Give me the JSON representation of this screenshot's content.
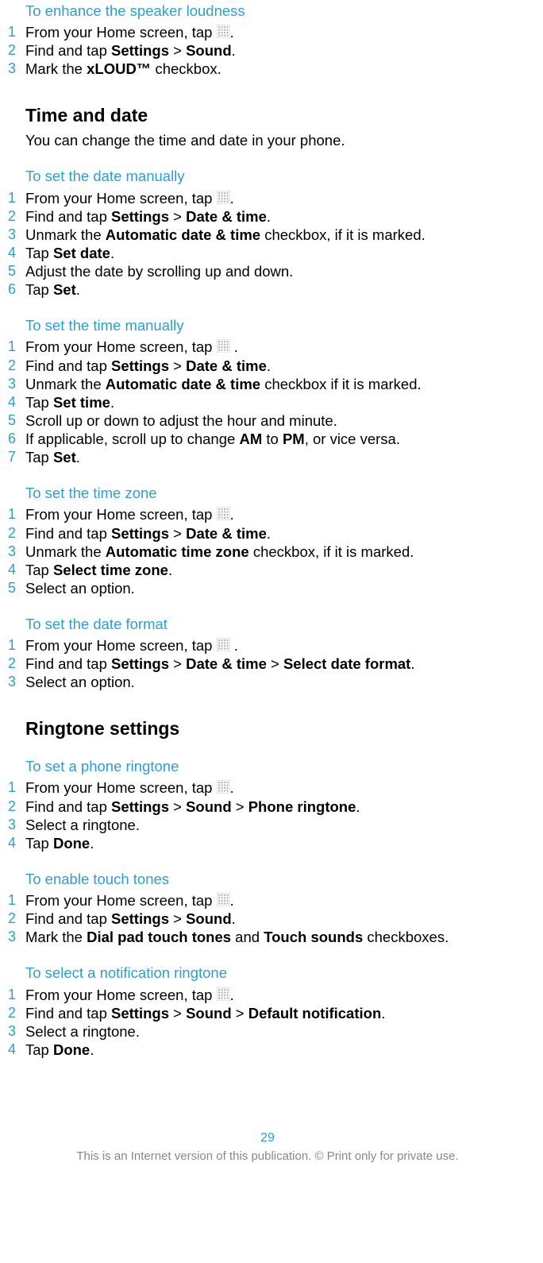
{
  "sections": [
    {
      "heading": "To enhance the speaker loudness",
      "first": true,
      "steps": [
        [
          {
            "t": "From your Home screen, tap "
          },
          {
            "icon": "apps"
          },
          {
            "t": "."
          }
        ],
        [
          {
            "t": "Find and tap "
          },
          {
            "b": "Settings"
          },
          {
            "t": " > "
          },
          {
            "b": "Sound"
          },
          {
            "t": "."
          }
        ],
        [
          {
            "t": "Mark the "
          },
          {
            "b": "xLOUD™"
          },
          {
            "t": " checkbox."
          }
        ]
      ]
    },
    {
      "h2": "Time and date",
      "intro": "You can change the time and date in your phone."
    },
    {
      "heading": "To set the date manually",
      "steps": [
        [
          {
            "t": "From your Home screen, tap "
          },
          {
            "icon": "apps"
          },
          {
            "t": "."
          }
        ],
        [
          {
            "t": "Find and tap "
          },
          {
            "b": "Settings"
          },
          {
            "t": " > "
          },
          {
            "b": "Date & time"
          },
          {
            "t": "."
          }
        ],
        [
          {
            "t": "Unmark the "
          },
          {
            "b": "Automatic date & time"
          },
          {
            "t": " checkbox, if it is marked."
          }
        ],
        [
          {
            "t": "Tap "
          },
          {
            "b": "Set date"
          },
          {
            "t": "."
          }
        ],
        [
          {
            "t": "Adjust the date by scrolling up and down."
          }
        ],
        [
          {
            "t": "Tap "
          },
          {
            "b": "Set"
          },
          {
            "t": "."
          }
        ]
      ]
    },
    {
      "heading": "To set the time manually",
      "steps": [
        [
          {
            "t": "From your Home screen, tap "
          },
          {
            "icon": "apps"
          },
          {
            "t": " ."
          }
        ],
        [
          {
            "t": "Find and tap "
          },
          {
            "b": "Settings"
          },
          {
            "t": " > "
          },
          {
            "b": "Date & time"
          },
          {
            "t": "."
          }
        ],
        [
          {
            "t": "Unmark the "
          },
          {
            "b": "Automatic date & time"
          },
          {
            "t": " checkbox if it is marked."
          }
        ],
        [
          {
            "t": "Tap "
          },
          {
            "b": "Set time"
          },
          {
            "t": "."
          }
        ],
        [
          {
            "t": "Scroll up or down to adjust the hour and minute."
          }
        ],
        [
          {
            "t": "If applicable, scroll up to change "
          },
          {
            "b": "AM"
          },
          {
            "t": " to "
          },
          {
            "b": "PM"
          },
          {
            "t": ", or vice versa."
          }
        ],
        [
          {
            "t": "Tap "
          },
          {
            "b": "Set"
          },
          {
            "t": "."
          }
        ]
      ]
    },
    {
      "heading": "To set the time zone",
      "steps": [
        [
          {
            "t": "From your Home screen, tap "
          },
          {
            "icon": "apps"
          },
          {
            "t": "."
          }
        ],
        [
          {
            "t": "Find and tap "
          },
          {
            "b": "Settings"
          },
          {
            "t": " > "
          },
          {
            "b": "Date & time"
          },
          {
            "t": "."
          }
        ],
        [
          {
            "t": "Unmark the "
          },
          {
            "b": "Automatic time zone"
          },
          {
            "t": " checkbox, if it is marked."
          }
        ],
        [
          {
            "t": "Tap "
          },
          {
            "b": "Select time zone"
          },
          {
            "t": "."
          }
        ],
        [
          {
            "t": "Select an option."
          }
        ]
      ]
    },
    {
      "heading": "To set the date format",
      "steps": [
        [
          {
            "t": "From your Home screen, tap "
          },
          {
            "icon": "apps"
          },
          {
            "t": " ."
          }
        ],
        [
          {
            "t": "Find and tap "
          },
          {
            "b": "Settings"
          },
          {
            "t": " > "
          },
          {
            "b": "Date & time"
          },
          {
            "t": " > "
          },
          {
            "b": "Select date format"
          },
          {
            "t": "."
          }
        ],
        [
          {
            "t": "Select an option."
          }
        ]
      ]
    },
    {
      "h2": "Ringtone settings"
    },
    {
      "heading": "To set a phone ringtone",
      "steps": [
        [
          {
            "t": "From your Home screen, tap "
          },
          {
            "icon": "apps"
          },
          {
            "t": "."
          }
        ],
        [
          {
            "t": "Find and tap "
          },
          {
            "b": "Settings"
          },
          {
            "t": " > "
          },
          {
            "b": "Sound"
          },
          {
            "t": " > "
          },
          {
            "b": "Phone ringtone"
          },
          {
            "t": "."
          }
        ],
        [
          {
            "t": "Select a ringtone."
          }
        ],
        [
          {
            "t": "Tap "
          },
          {
            "b": "Done"
          },
          {
            "t": "."
          }
        ]
      ]
    },
    {
      "heading": "To enable touch tones",
      "steps": [
        [
          {
            "t": "From your Home screen, tap "
          },
          {
            "icon": "apps"
          },
          {
            "t": "."
          }
        ],
        [
          {
            "t": "Find and tap "
          },
          {
            "b": "Settings"
          },
          {
            "t": " > "
          },
          {
            "b": "Sound"
          },
          {
            "t": "."
          }
        ],
        [
          {
            "t": "Mark the "
          },
          {
            "b": "Dial pad touch tones"
          },
          {
            "t": " and "
          },
          {
            "b": "Touch sounds"
          },
          {
            "t": " checkboxes."
          }
        ]
      ]
    },
    {
      "heading": "To select a notification ringtone",
      "steps": [
        [
          {
            "t": "From your Home screen, tap "
          },
          {
            "icon": "apps"
          },
          {
            "t": "."
          }
        ],
        [
          {
            "t": "Find and tap "
          },
          {
            "b": "Settings"
          },
          {
            "t": " > "
          },
          {
            "b": "Sound"
          },
          {
            "t": " > "
          },
          {
            "b": "Default notification"
          },
          {
            "t": "."
          }
        ],
        [
          {
            "t": "Select a ringtone."
          }
        ],
        [
          {
            "t": "Tap "
          },
          {
            "b": "Done"
          },
          {
            "t": "."
          }
        ]
      ]
    }
  ],
  "pageNumber": "29",
  "footer": "This is an Internet version of this publication. © Print only for private use."
}
